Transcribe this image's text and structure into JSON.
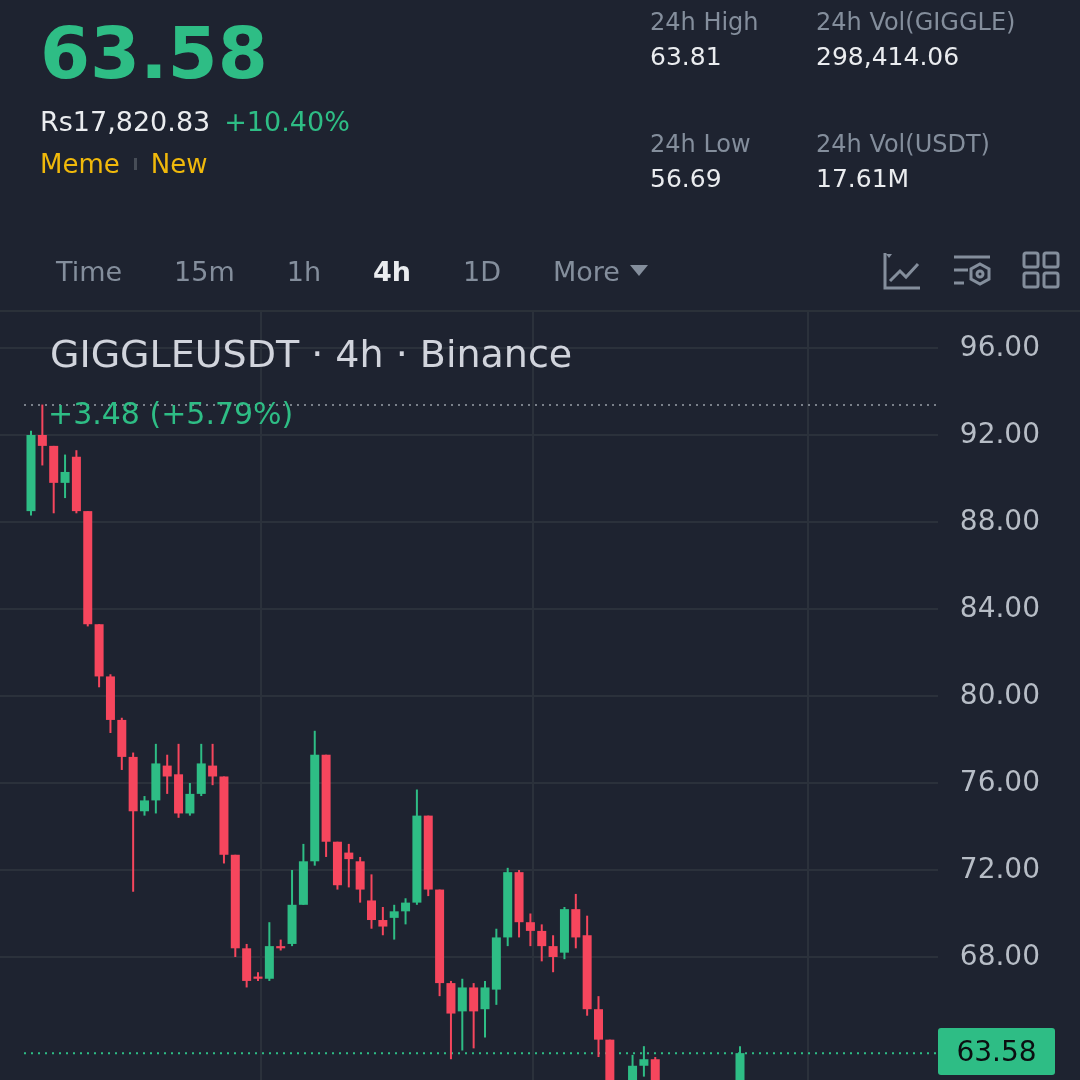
{
  "price": "63.58",
  "fiat_price": "Rs17,820.83",
  "change": "+10.40%",
  "tags": [
    "Meme",
    "New"
  ],
  "stats": [
    {
      "label": "24h High",
      "value": "63.81"
    },
    {
      "label": "24h Vol(GIGGLE)",
      "value": "298,414.06"
    },
    {
      "label": "24h Low",
      "value": "56.69"
    },
    {
      "label": "24h Vol(USDT)",
      "value": "17.61M"
    }
  ],
  "intervals": [
    {
      "label": "Time",
      "selected": false
    },
    {
      "label": "15m",
      "selected": false
    },
    {
      "label": "1h",
      "selected": false
    },
    {
      "label": "4h",
      "selected": true
    },
    {
      "label": "1D",
      "selected": false
    }
  ],
  "more": {
    "label": "More"
  },
  "chart": {
    "legend": "GIGGLEUSDT · 4h · Binance",
    "change_label": "+3.48 (+5.79%)",
    "y_labels": [
      "96.00",
      "92.00",
      "88.00",
      "84.00",
      "80.00",
      "76.00",
      "72.00",
      "68.00"
    ],
    "last_price": "63.58"
  }
}
